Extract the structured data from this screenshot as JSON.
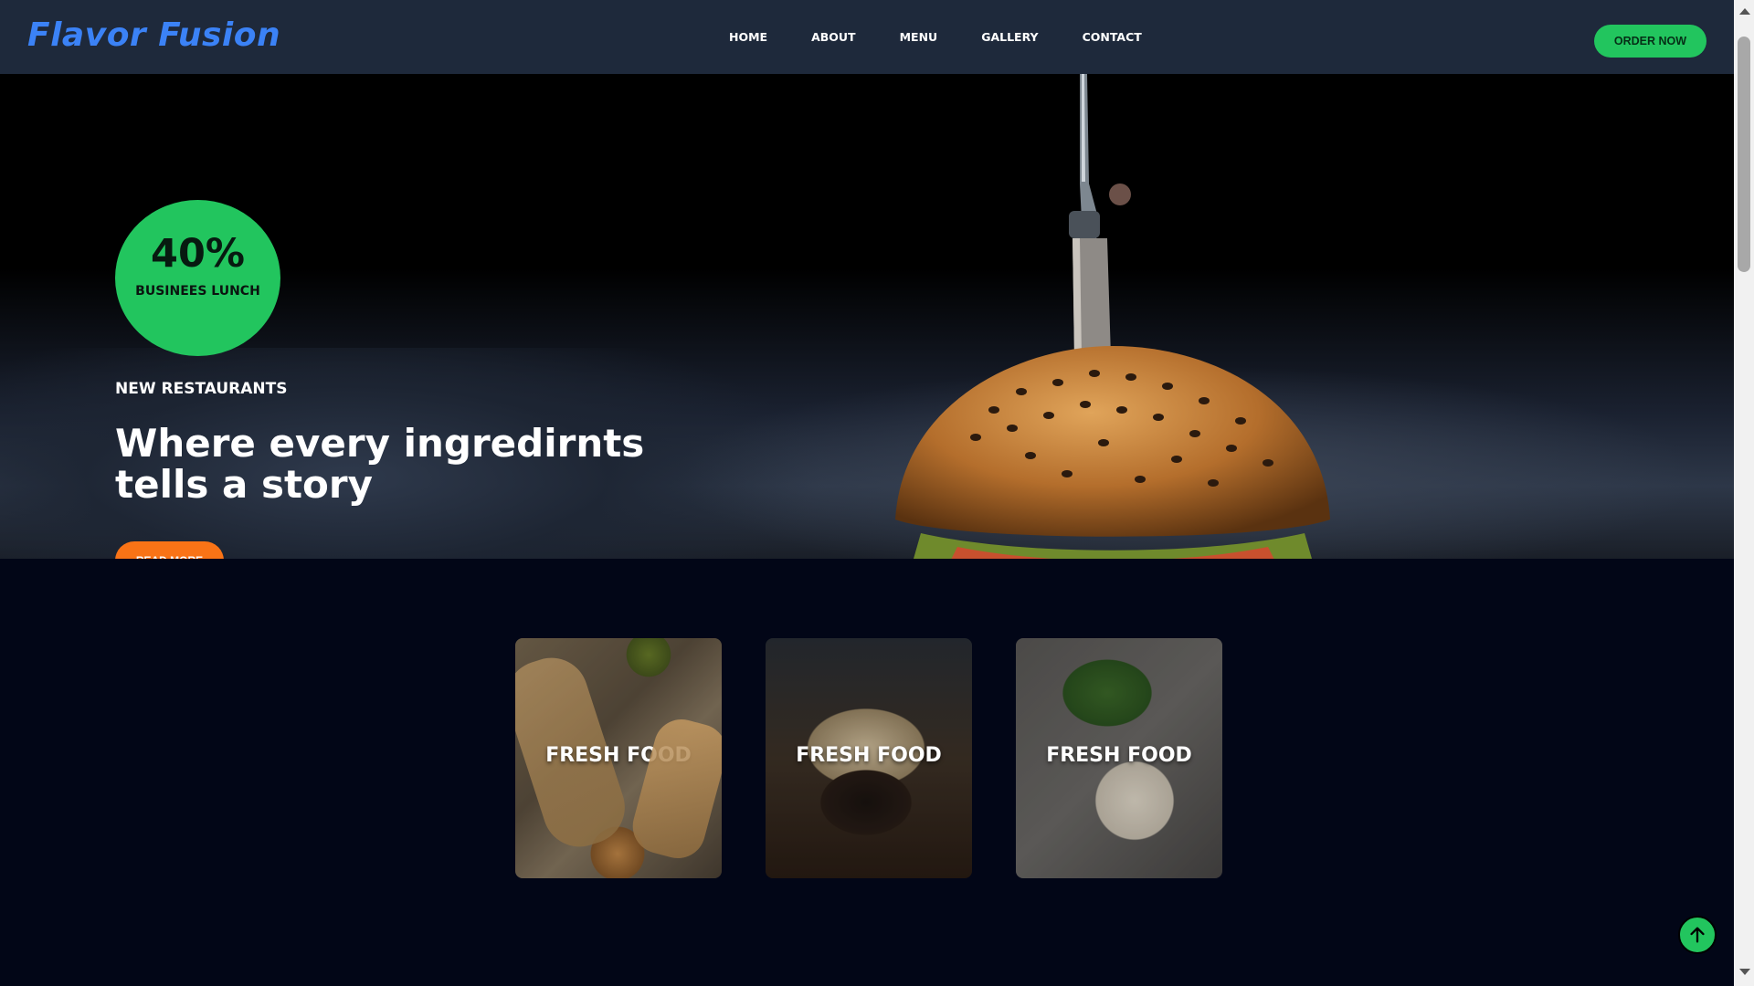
{
  "header": {
    "logo": "Flavor Fusion",
    "nav": [
      "HOME",
      "ABOUT",
      "MENU",
      "GALLERY",
      "CONTACT"
    ],
    "order_button": "ORDER NOW"
  },
  "hero": {
    "badge_value": "40%",
    "badge_label": "BUSINEES LUNCH",
    "eyebrow": "NEW RESTAURANTS",
    "headline": "Where every ingredirnts tells a story",
    "read_more": "READ MORE"
  },
  "cards": [
    {
      "title": "FRESH FOOD"
    },
    {
      "title": "FRESH FOOD"
    },
    {
      "title": "FRESH FOOD"
    }
  ],
  "colors": {
    "accent_green": "#22c55e",
    "accent_orange": "#f97316",
    "logo_blue": "#3b82f6",
    "header_bg": "#1e293b",
    "page_bg": "#020617"
  },
  "icons": {
    "to_top": "arrow-up-icon"
  }
}
